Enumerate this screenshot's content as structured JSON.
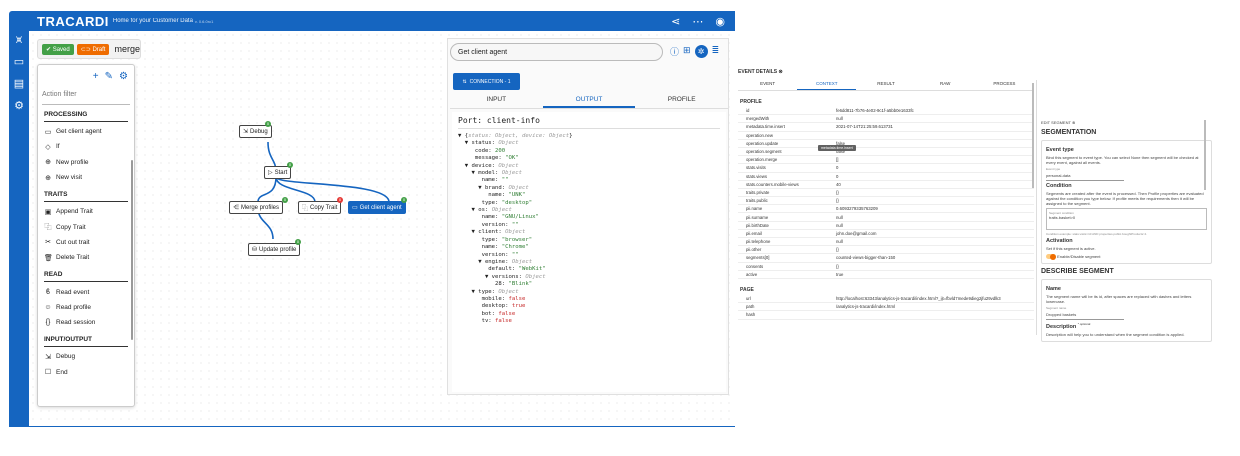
{
  "app": {
    "logo": "TRACARDI",
    "subtitle": "Home for your Customer Data",
    "version": "v. 0.6.0rc1"
  },
  "rail_icons": [
    "antenna-icon",
    "folder-icon",
    "dashboard-icon",
    "settings-icon"
  ],
  "colors": {
    "brand": "#1565c0",
    "saved": "#43a047",
    "draft": "#ef6c00",
    "error": "#e53935"
  },
  "flow": {
    "saved_label": "Saved",
    "draft_label": "Draft",
    "name": "merge"
  },
  "actions": {
    "filter_placeholder": "Action filter",
    "sections": [
      {
        "title": "PROCESSING",
        "items": [
          {
            "icon": "▭",
            "label": "Get client agent"
          },
          {
            "icon": "◇",
            "label": "If"
          },
          {
            "icon": "⊕",
            "label": "New profile"
          },
          {
            "icon": "⊕",
            "label": "New visit"
          }
        ]
      },
      {
        "title": "TRAITS",
        "items": [
          {
            "icon": "▣",
            "label": "Append Trait"
          },
          {
            "icon": "⿻",
            "label": "Copy Trait"
          },
          {
            "icon": "✂",
            "label": "Cut out trait"
          },
          {
            "icon": "🗑",
            "label": "Delete Trait"
          }
        ]
      },
      {
        "title": "READ",
        "items": [
          {
            "icon": "ϐ",
            "label": "Read event"
          },
          {
            "icon": "☺",
            "label": "Read profile"
          },
          {
            "icon": "{}",
            "label": "Read session"
          }
        ]
      },
      {
        "title": "INPUT/OUTPUT",
        "items": [
          {
            "icon": "⇲",
            "label": "Debug"
          },
          {
            "icon": "☐",
            "label": "End"
          }
        ]
      }
    ]
  },
  "nodes": {
    "debug": {
      "label": "Debug",
      "badge": "0"
    },
    "start": {
      "label": "Start",
      "badge": "0"
    },
    "merge": {
      "label": "Merge profiles",
      "badge": "0"
    },
    "copy": {
      "label": "Copy Trait",
      "badge": "0"
    },
    "client": {
      "label": "Get client agent",
      "badge": "0"
    },
    "update": {
      "label": "Update profile",
      "badge": "0"
    }
  },
  "details": {
    "title": "Get client agent",
    "connection": "CONNECTION - 1",
    "tabs": [
      "INPUT",
      "OUTPUT",
      "PROFILE"
    ],
    "port_title": "Port: client-info"
  },
  "event_details": {
    "header": "EVENT DETAILS",
    "tabs": [
      "EVENT",
      "CONTEXT",
      "RESULT",
      "RAW",
      "PROCESS"
    ],
    "profile_header": "PROFILE",
    "tooltip": "metadata.time.insert",
    "rows": [
      [
        "id",
        "fe6dd811-7b76-4e02-9c1f-a5bb0e1633fc"
      ],
      [
        "mergedWith",
        "null"
      ],
      [
        "metadata.time.insert",
        "2021-07-14T21:25:59.613731"
      ],
      [
        "operation.new",
        ""
      ],
      [
        "operation.update",
        "false"
      ],
      [
        "operation.segment",
        "false"
      ],
      [
        "operation.merge",
        "[]"
      ],
      [
        "stats.visits",
        "0"
      ],
      [
        "stats.views",
        "0"
      ],
      [
        "stats.counters.mobile-views",
        "40"
      ],
      [
        "traits.private",
        "{}"
      ],
      [
        "traits.public",
        "{}"
      ],
      [
        "pii.name",
        "0.6093279335763209"
      ],
      [
        "pii.surname",
        "null"
      ],
      [
        "pii.birthDate",
        "null"
      ],
      [
        "pii.email",
        "john.doe@gmail.com"
      ],
      [
        "pii.telephone",
        "null"
      ],
      [
        "pii.other",
        "{}"
      ],
      [
        "segments[0]",
        "counted-views-bigger-than-150"
      ],
      [
        "consents",
        "{}"
      ],
      [
        "active",
        "true"
      ]
    ],
    "page_header": "PAGE",
    "page_rows": [
      [
        "url",
        "http://localhost:63343/analytics-js-tracardi/index.html?_ijt=fbvld7mede9dieg2jfu29vdlk3"
      ],
      [
        "path",
        "/analytics-js-tracardi/index.html"
      ],
      [
        "hash",
        ""
      ]
    ]
  },
  "segment": {
    "edit_header": "EDIT SEGMENT",
    "title": "SEGMENTATION",
    "event_type_title": "Event type",
    "event_type_desc": "Bind this segment to event type. You can select None then segment will be checked at every event, against all events.",
    "event_type_label": "Event type",
    "event_type_value": "personal-data",
    "condition_title": "Condition",
    "condition_desc": "Segments are created after the event is processed. Then Profile properties are evaluated against the condition you type below. If profile meets the requirements then it will be assigned to the segment.",
    "condition_label": "Segment condition",
    "condition_value": "traits.basket>0",
    "condition_hint": "Condition example: stats.visits>10 AND properties.public.boughtProducts>1",
    "activation_title": "Activation",
    "activation_desc": "Set if this segment is active.",
    "activation_toggle": "Enable/Disable segment",
    "describe_title": "DESCRIBE SEGMENT",
    "name_title": "Name",
    "name_desc": "The segment name will be its id, after spaces are replaced with dashes and letters lowercase.",
    "name_label": "Segment name",
    "name_value": "Dropped baskets",
    "desc_title": "Description",
    "desc_optional": "* optional",
    "desc_desc": "Description will help you to understand when the segment condition is applied."
  }
}
